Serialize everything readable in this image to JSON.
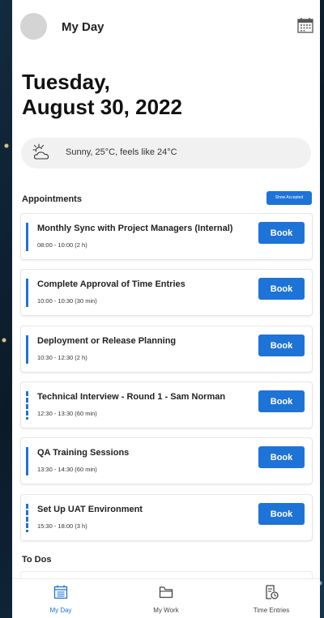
{
  "header": {
    "title": "My Day"
  },
  "date": {
    "line1": "Tuesday,",
    "line2": "August 30, 2022"
  },
  "weather": {
    "text": "Sunny, 25°C, feels like 24°C",
    "icon": "partly-sunny-icon"
  },
  "appointments": {
    "heading": "Appointments",
    "show_accepted_label": "Show Accepted",
    "book_label": "Book",
    "items": [
      {
        "title": "Monthly Sync with Project Managers (Internal)",
        "time": "08:00 - 10:00 (2 h)",
        "bar": "solid"
      },
      {
        "title": "Complete Approval of Time Entries",
        "time": "10:00 - 10:30 (30 min)",
        "bar": "solid"
      },
      {
        "title": "Deployment or Release Planning",
        "time": "10:30 - 12:30 (2 h)",
        "bar": "solid"
      },
      {
        "title": "Technical Interview - Round 1 - Sam Norman",
        "time": "12:30 - 13:30 (60 min)",
        "bar": "dashed"
      },
      {
        "title": "QA Training Sessions",
        "time": "13:30 - 14:30 (60 min)",
        "bar": "solid"
      },
      {
        "title": "Set Up UAT Environment",
        "time": "15:30 - 18:00 (3 h)",
        "bar": "dashed"
      }
    ]
  },
  "todos": {
    "heading": "To Dos"
  },
  "nav": {
    "items": [
      {
        "label": "My Day",
        "icon": "calendar-list-icon",
        "active": true
      },
      {
        "label": "My Work",
        "icon": "folder-icon",
        "active": false
      },
      {
        "label": "Time Entries",
        "icon": "time-entry-icon",
        "active": false
      }
    ]
  },
  "colors": {
    "accent": "#1e73d7",
    "background": "#0e2233"
  }
}
